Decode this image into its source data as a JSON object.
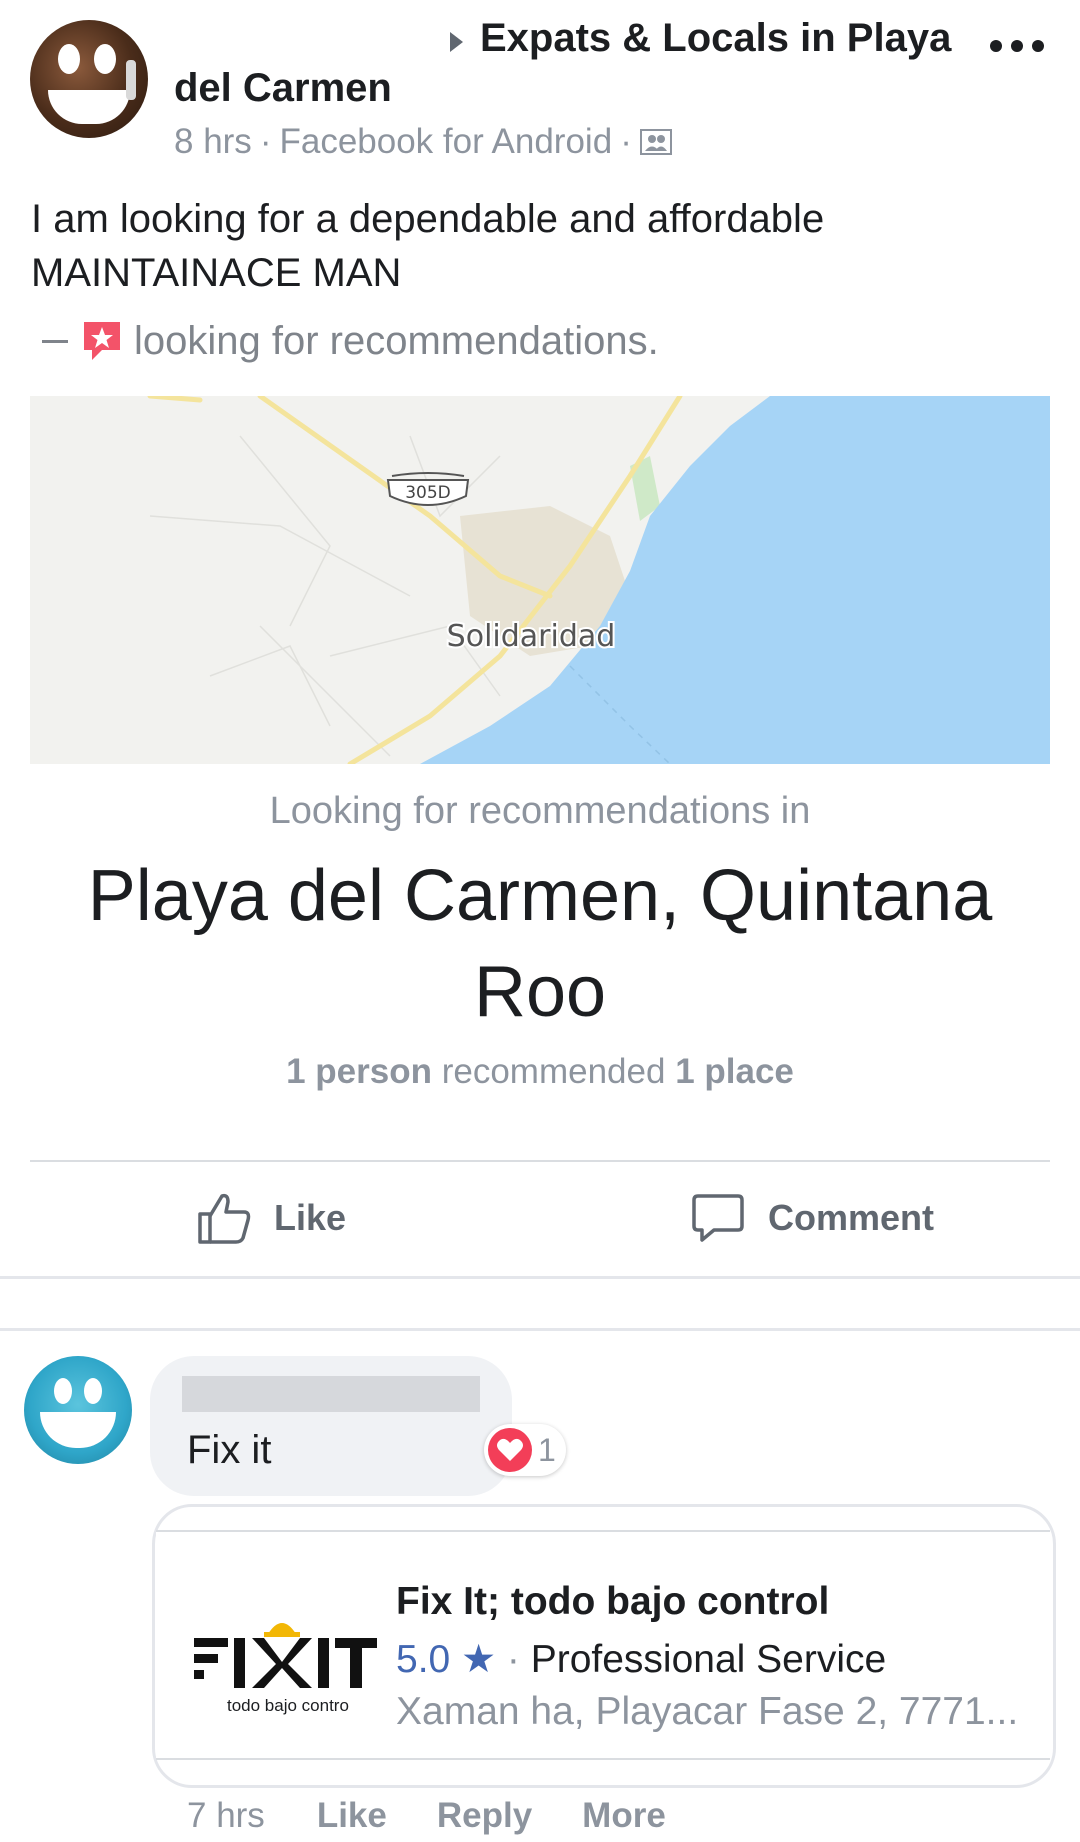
{
  "post": {
    "group_name": "Expats & Locals in Playa",
    "author_name": "del Carmen",
    "time": "8 hrs",
    "meta_sep": "·",
    "source": "Facebook for Android",
    "text_line1": "I am looking for a dependable and affordable",
    "text_line2": "MAINTAINACE MAN",
    "activity": "looking for recommendations.",
    "map": {
      "highway_label": "305D",
      "place_label": "Solidaridad"
    },
    "rec_in_label": "Looking for recommendations in",
    "place_line1": "Playa del Carmen, Quintana",
    "place_line2": "Roo",
    "rec_count": {
      "people": "1 person",
      "middle": "recommended",
      "places": "1 place"
    }
  },
  "actions": {
    "like_label": "Like",
    "comment_label": "Comment"
  },
  "comment": {
    "text": "Fix it",
    "reaction_count": "1",
    "card": {
      "logo_sub": "todo bajo contro",
      "title": "Fix It; todo bajo control",
      "rating": "5.0",
      "star": "★",
      "sep": "·",
      "category": "Professional Service",
      "address": "Xaman ha, Playacar Fase 2, 7771..."
    },
    "time": "7 hrs",
    "like_label": "Like",
    "reply_label": "Reply",
    "more_label": "More"
  },
  "icons": {
    "group_arrow": "caret-right-icon",
    "more": "more-dots-icon",
    "privacy": "group-privacy-icon",
    "recommendation": "recommendation-star-icon",
    "like": "thumbs-up-icon",
    "comment": "speech-bubble-icon",
    "reaction": "heart-icon"
  },
  "colors": {
    "text_primary": "#1c1e21",
    "text_secondary": "#8d949e",
    "link_blue": "#4267b2",
    "heart_red": "#f33e58",
    "map_water": "#a6d4f6",
    "map_road": "#f4e49c"
  }
}
